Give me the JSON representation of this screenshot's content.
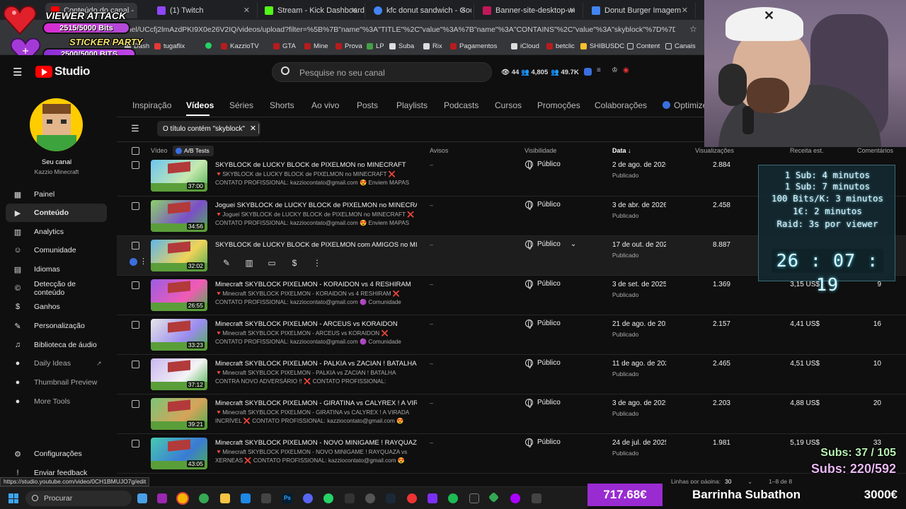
{
  "browser": {
    "tabs": [
      {
        "label": "Conteúdo do canal - YouTube",
        "color": "#ff0000"
      },
      {
        "label": "(1) Twitch",
        "color": "#9146ff"
      },
      {
        "label": "Stream - Kick Dashboard",
        "color": "#53fc18"
      },
      {
        "label": "kfc donut sandwich - Google S",
        "color": "#4285f4"
      },
      {
        "label": "Banner-site-desktop-webp-se",
        "color": "#c2185b"
      },
      {
        "label": "Donut Burger Imagem Alta Q",
        "color": "#4285f4"
      }
    ],
    "url": "/channel/UCcfj2lmAzdPKI9X0e26V2IQ/videos/upload?filter=%5B%7B\"name\"%3A\"TITLE\"%2C\"value\"%3A%7B\"name\"%3A\"CONTAINS\"%2C\"value\"%3A\"skyblock\"%7D%7D%5D&sort=%7B\"c...",
    "bookmarks": [
      "Dash",
      "tugaflix",
      "KazzioTV",
      "GTA",
      "Mine",
      "Prova",
      "LP",
      "Suba",
      "Rix",
      "Pagamentos",
      "iCloud",
      "betclic",
      "SHIBUSDC",
      "Content",
      "Canais"
    ]
  },
  "overlay_left": {
    "viewer_attack_label": "VIEWER ATTACK",
    "viewer_attack_value": "2515/5000 Bits",
    "sticker_party_label": "STICKER PARTY",
    "sticker_party_value": "2500/5000 BITS"
  },
  "header": {
    "logo": "Studio",
    "search_placeholder": "Pesquise no seu canal",
    "stats": [
      "44",
      "4,805",
      "49.7K"
    ]
  },
  "channel": {
    "label": "Seu canal",
    "name": "Kazzio Minecraft"
  },
  "sidebar": {
    "items": [
      {
        "label": "Painel",
        "icon": "dashboard-icon"
      },
      {
        "label": "Conteúdo",
        "icon": "content-icon"
      },
      {
        "label": "Analytics",
        "icon": "analytics-icon"
      },
      {
        "label": "Comunidade",
        "icon": "community-icon"
      },
      {
        "label": "Idiomas",
        "icon": "languages-icon"
      },
      {
        "label": "Detecção de conteúdo",
        "icon": "detection-icon"
      },
      {
        "label": "Ganhos",
        "icon": "earnings-icon"
      },
      {
        "label": "Personalização",
        "icon": "customization-icon"
      },
      {
        "label": "Biblioteca de áudio",
        "icon": "audio-library-icon"
      },
      {
        "label": "Daily Ideas",
        "icon": "daily-ideas-icon"
      },
      {
        "label": "Thumbnail Preview",
        "icon": "thumbnail-preview-icon"
      },
      {
        "label": "More Tools",
        "icon": "more-tools-icon"
      }
    ],
    "settings": "Configurações",
    "feedback": "Enviar feedback"
  },
  "tabs": [
    "Inspiração",
    "Vídeos",
    "Séries",
    "Shorts",
    "Ao vivo",
    "Posts",
    "Playlists",
    "Podcasts",
    "Cursos",
    "Promoções",
    "Colaborações",
    "Optimize"
  ],
  "filter_chip": "O título contém \"skyblock\"",
  "table": {
    "headers": {
      "video": "Vídeo",
      "ab": "A/B Tests",
      "warnings": "Avisos",
      "visibility": "Visibilidade",
      "date": "Data",
      "views": "Visualizações",
      "revenue": "Receita est.",
      "comments": "Comentários"
    },
    "rows": [
      {
        "title": "SKYBLOCK de LUCKY BLOCK de PIXELMON no MINECRAFT",
        "desc": "🔻SKYBLOCK de LUCKY BLOCK de PIXELMON no MINECRAFT ❌ CONTATO PROFISSIONAL: kazziocontato@gmail.com 😍 Enviem MAPAS de LUCKY...",
        "duration": "37:00",
        "warn": "–",
        "visibility": "Público",
        "date": "2 de ago. de 2026",
        "status": "Publicado",
        "views": "2.884",
        "revenue": "",
        "comments": ""
      },
      {
        "title": "Joguei SKYBLOCK de LUCKY BLOCK de PIXELMON no MINECRAFT",
        "desc": "🔻Joguei SKYBLOCK de LUCKY BLOCK de PIXELMON no MINECRAFT ❌ CONTATO PROFISSIONAL: kazziocontato@gmail.com 😍 Enviem MAPAS de...",
        "duration": "34:56",
        "warn": "–",
        "visibility": "Público",
        "date": "3 de abr. de 2026",
        "status": "Publicado",
        "views": "2.458",
        "revenue": "",
        "comments": ""
      },
      {
        "title": "SKYBLOCK de LUCKY BLOCK de PIXELMON com AMIGOS no MINE...",
        "desc": "",
        "duration": "32:02",
        "warn": "–",
        "visibility": "Público",
        "date": "17 de out. de 2025",
        "status": "Publicado",
        "views": "8.887",
        "revenue": "",
        "comments": ""
      },
      {
        "title": "Minecraft SKYBLOCK PIXELMON - KORAIDON vs 4 RESHIRAM",
        "desc": "🔻Minecraft SKYBLOCK PIXELMON - KORAIDON vs 4 RESHIRAM ❌ CONTATO PROFISSIONAL: kazziocontato@gmail.com 🟣 Comunidade Discord Kazzio...",
        "duration": "26:55",
        "warn": "–",
        "visibility": "Público",
        "date": "3 de set. de 2025",
        "status": "Publicado",
        "views": "1.369",
        "revenue": "3,15 US$",
        "comments": "9"
      },
      {
        "title": "Minecraft SKYBLOCK PIXELMON - ARCEUS vs KORAIDON",
        "desc": "🔻Minecraft SKYBLOCK PIXELMON - ARCEUS vs KORAIDON ❌ CONTATO PROFISSIONAL: kazziocontato@gmail.com 🟣 Comunidade Discord Kazzio...",
        "duration": "33:23",
        "warn": "–",
        "visibility": "Público",
        "date": "21 de ago. de 202",
        "status": "Publicado",
        "views": "2.157",
        "revenue": "4,41 US$",
        "comments": "16"
      },
      {
        "title": "Minecraft SKYBLOCK PIXELMON - PALKIA vs ZACIAN ! BATALHA C...",
        "desc": "🔻Minecraft SKYBLOCK PIXELMON - PALKIA vs ZACIAN ! BATALHA CONTRA NOVO ADVERSÁRIO !! ❌ CONTATO PROFISSIONAL: kazziocontato@gmail.co...",
        "duration": "37:12",
        "warn": "–",
        "visibility": "Público",
        "date": "11 de ago. de 202",
        "status": "Publicado",
        "views": "2.465",
        "revenue": "4,51 US$",
        "comments": "10"
      },
      {
        "title": "Minecraft SKYBLOCK PIXELMON - GIRATINA vs CALYREX ! A VIRA...",
        "desc": "🔻Minecraft SKYBLOCK PIXELMON - GIRATINA vs CALYREX ! A VIRADA INCRÍVEL ❌ CONTATO PROFISSIONAL: kazziocontato@gmail.com 😍 Envie...",
        "duration": "39:21",
        "warn": "–",
        "visibility": "Público",
        "date": "3 de ago. de 2025",
        "status": "Publicado",
        "views": "2.203",
        "revenue": "4,88 US$",
        "comments": "20"
      },
      {
        "title": "Minecraft SKYBLOCK PIXELMON - NOVO MINIGAME ! RAYQUAZA v...",
        "desc": "🔻Minecraft SKYBLOCK PIXELMON - NOVO MINIGAME ! RAYQUAZA vs XERNEAS ❌ CONTATO PROFISSIONAL: kazziocontato@gmail.com 😍 Envie...",
        "duration": "43:05",
        "warn": "–",
        "visibility": "Público",
        "date": "24 de jul. de 2025",
        "status": "Publicado",
        "views": "1.981",
        "revenue": "5,19 US$",
        "comments": "33"
      }
    ]
  },
  "pagination": {
    "label": "Linhas por página:",
    "per_page": "30",
    "range": "1–8 de 8"
  },
  "timer_box": {
    "lines": [
      "1 Sub: 4 minutos",
      "1 Sub: 7 minutos",
      "100 Bits/K: 3 minutos",
      "1€: 2 minutos",
      "Raid: 3s por viewer"
    ],
    "time": "26 : 07 : 19"
  },
  "subs": {
    "line1": "Subs: 37 / 105",
    "line2": "Subs: 220/592"
  },
  "status_url": "https://studio.youtube.com/video/0CH1BMUJO7g/edit",
  "taskbar": {
    "search": "Procurar"
  },
  "subathon": {
    "amount": "717.68€",
    "label": "Barrinha Subathon",
    "goal": "3000€"
  }
}
